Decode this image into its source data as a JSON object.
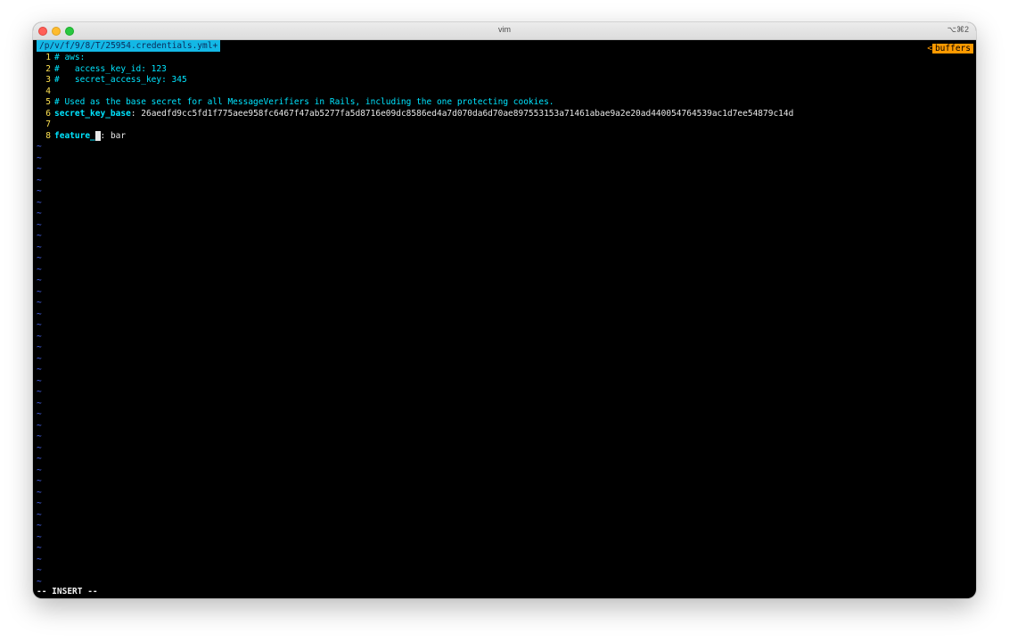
{
  "window": {
    "title": "vim",
    "shortcut": "⌥⌘2"
  },
  "tabline": {
    "active_tab": "/p/v/f/9/8/T/25954.credentials.yml+",
    "buffers_arrow": "<",
    "buffers_label": "buffers"
  },
  "editor": {
    "lines": [
      {
        "num": "1",
        "comment": "# aws:"
      },
      {
        "num": "2",
        "comment": "#   access_key_id: 123"
      },
      {
        "num": "3",
        "comment": "#   secret_access_key: 345"
      },
      {
        "num": "4",
        "empty": true
      },
      {
        "num": "5",
        "comment": "# Used as the base secret for all MessageVerifiers in Rails, including the one protecting cookies."
      },
      {
        "num": "6",
        "key": "secret_key_base",
        "sep": ": ",
        "value": "26aedfd9cc5fd1f775aee958fc6467f47ab5277fa5d8716e09dc8586ed4a7d070da6d70ae897553153a71461abae9a2e20ad440054764539ac1d7ee54879c14d"
      },
      {
        "num": "7",
        "empty": true
      },
      {
        "num": "8",
        "key": "feature_",
        "cursor_char": " ",
        "sep": ": ",
        "value": "bar"
      }
    ],
    "tilde_char": "~",
    "tilde_count": 40
  },
  "status": {
    "mode": "-- INSERT --"
  },
  "colors": {
    "tab_bg": "#13b8e6",
    "buffers_bg": "#ff9a00",
    "line_number": "#ffe352",
    "comment": "#00e5ff",
    "tilde": "#4d6bff"
  }
}
